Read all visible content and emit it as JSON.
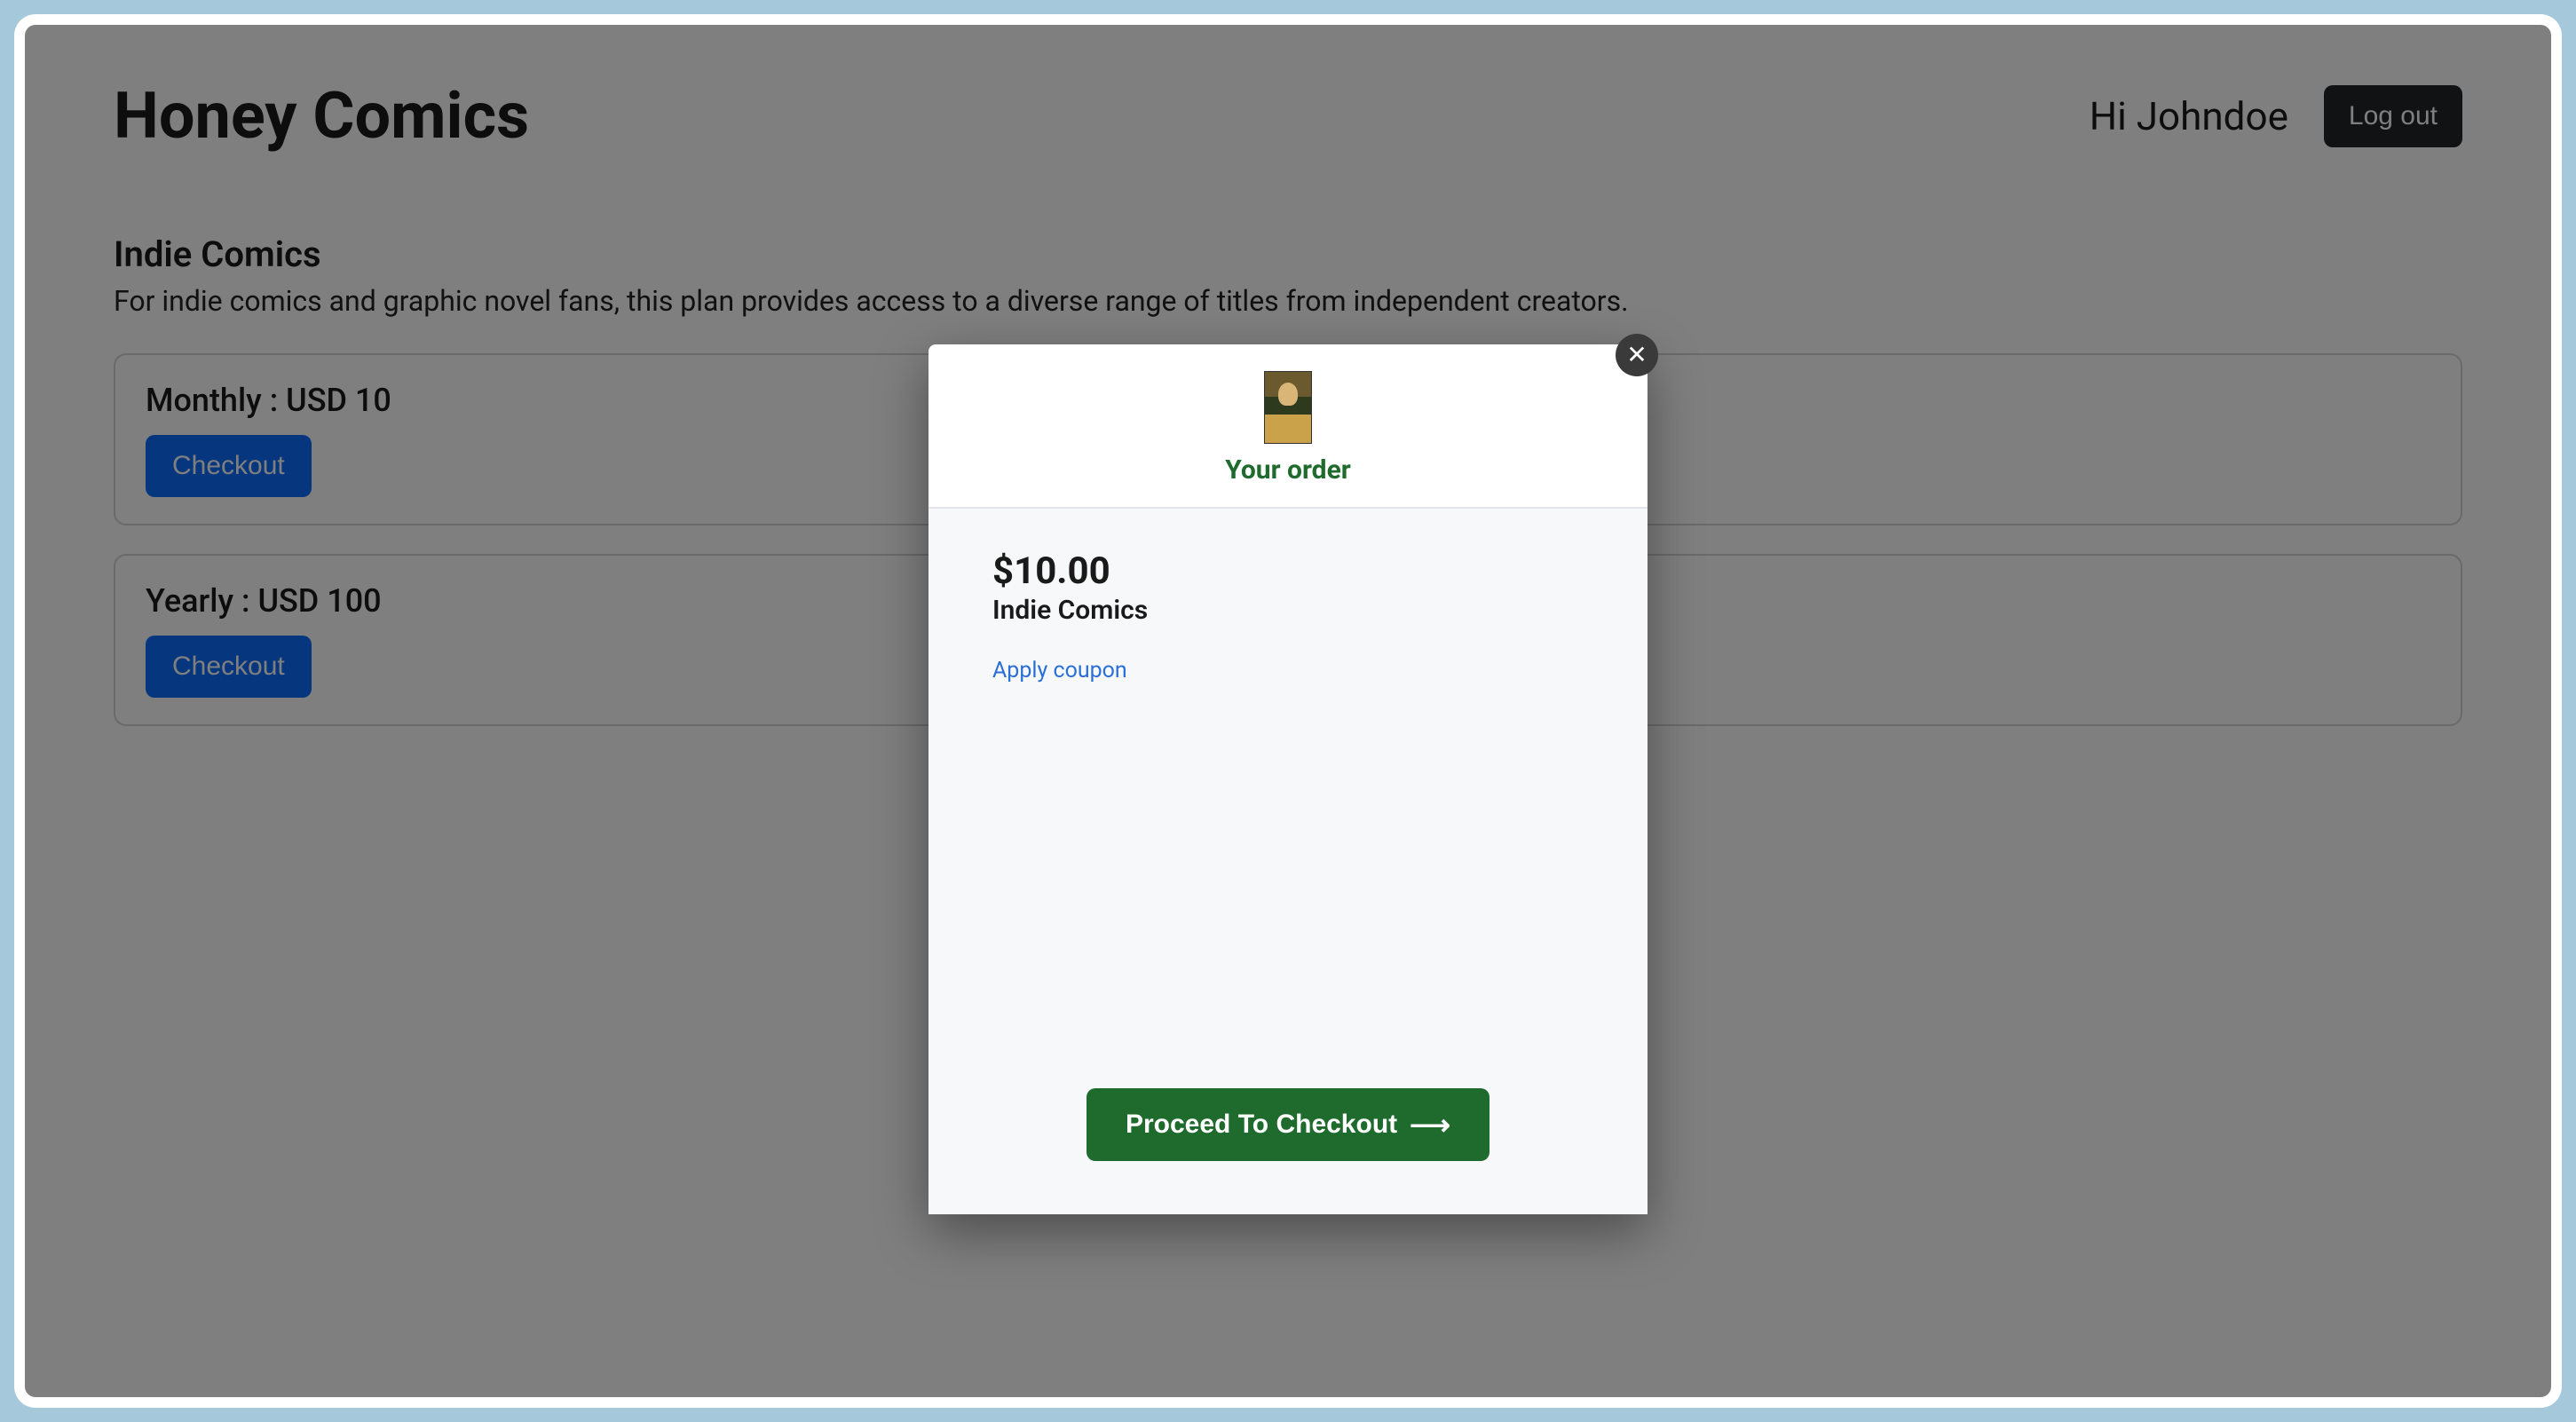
{
  "header": {
    "site_title": "Honey Comics",
    "greeting": "Hi Johndoe",
    "logout_label": "Log out"
  },
  "section": {
    "title": "Indie Comics",
    "description": "For indie comics and graphic novel fans, this plan provides access to a diverse range of titles from independent creators."
  },
  "plans": [
    {
      "label": "Monthly : USD 10",
      "button": "Checkout"
    },
    {
      "label": "Yearly : USD 100",
      "button": "Checkout"
    }
  ],
  "modal": {
    "title": "Your order",
    "price": "$10.00",
    "item_name": "Indie Comics",
    "apply_coupon": "Apply coupon",
    "proceed_label": "Proceed To Checkout"
  }
}
